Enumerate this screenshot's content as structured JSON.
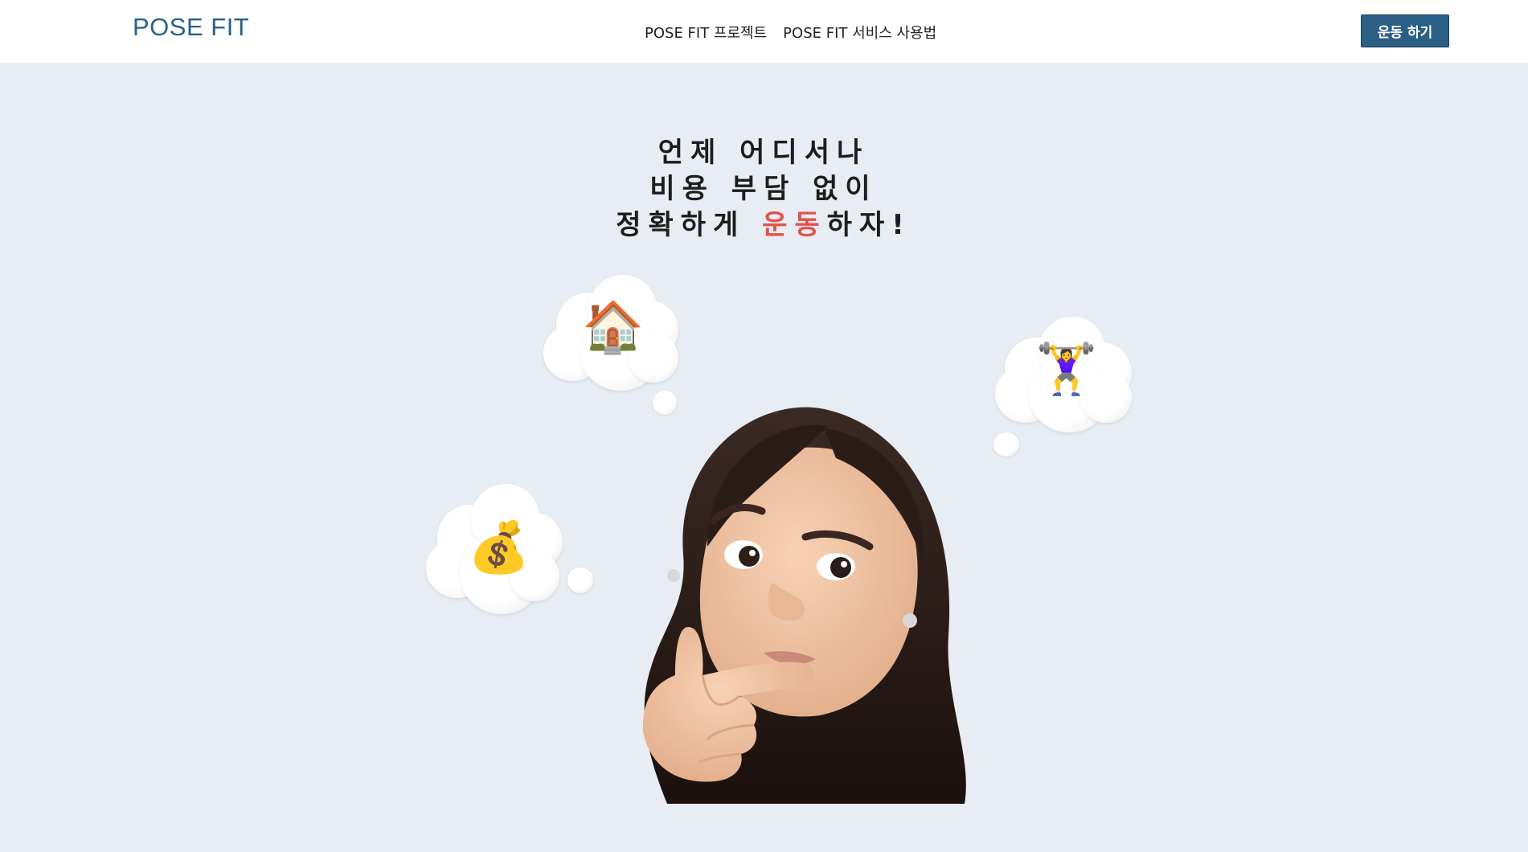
{
  "header": {
    "brand": "POSE FIT",
    "nav": [
      {
        "label": "POSE FIT 프로젝트"
      },
      {
        "label": "POSE FIT 서비스 사용법"
      }
    ],
    "cta_label": "운동 하기"
  },
  "hero": {
    "line1": "언제 어디서나",
    "line2": "비용 부담 없이",
    "line3_prefix": "정확하게 ",
    "line3_accent": "운동",
    "line3_suffix": "하자!",
    "accent_color": "#e0534a"
  },
  "illustration": {
    "clouds": [
      {
        "icon": "house-icon",
        "glyph": "🏠"
      },
      {
        "icon": "weightlifter-icon",
        "glyph": "🏋️‍♀️"
      },
      {
        "icon": "money-bag-icon",
        "glyph": "💰"
      }
    ],
    "avatar": "thinking-woman-memoji"
  },
  "colors": {
    "brand": "#2c5f86",
    "background": "#e8edf3",
    "accent": "#e0534a"
  }
}
